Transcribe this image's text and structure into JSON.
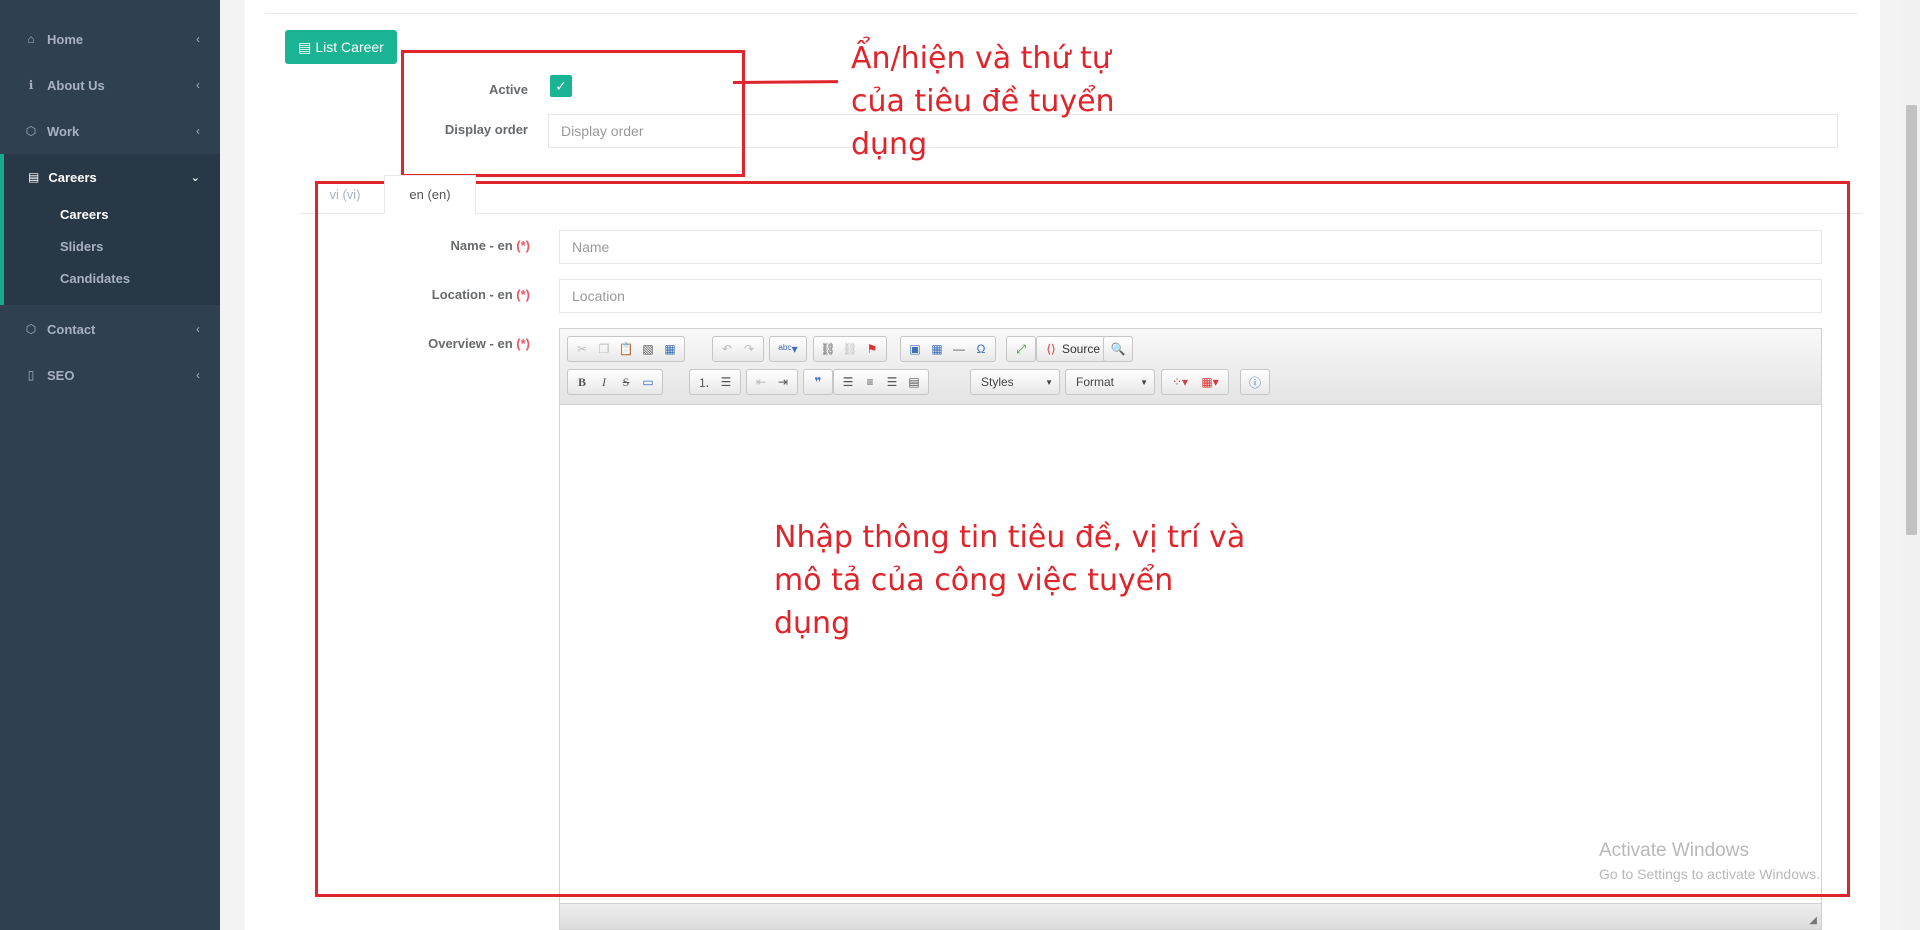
{
  "sidebar": {
    "items": [
      {
        "label": "Home",
        "icon": "home-icon"
      },
      {
        "label": "About Us",
        "icon": "info-icon"
      },
      {
        "label": "Work",
        "icon": "cube-icon"
      },
      {
        "label": "Careers",
        "icon": "id-card-icon"
      },
      {
        "label": "Contact",
        "icon": "cube-icon"
      },
      {
        "label": "SEO",
        "icon": "file-icon"
      }
    ],
    "careers_sub": [
      "Careers",
      "Sliders",
      "Candidates"
    ]
  },
  "header": {
    "list_button_label": "List Career"
  },
  "form": {
    "active_label": "Active",
    "active_checked": true,
    "display_order_label": "Display order",
    "display_order_placeholder": "Display order",
    "tabs": [
      {
        "label": "vi (vi)",
        "active": false
      },
      {
        "label": "en (en)",
        "active": true
      }
    ],
    "name_label": "Name - en",
    "location_label": "Location - en",
    "overview_label": "Overview - en",
    "required_mark": "(*)",
    "name_placeholder": "Name",
    "location_placeholder": "Location"
  },
  "editor": {
    "source_label": "Source",
    "styles_label": "Styles",
    "format_label": "Format"
  },
  "annotations": {
    "top_lines": [
      "Ẩn/hiện và thứ tự",
      "của tiêu đề tuyển",
      "dụng"
    ],
    "main_lines": [
      "Nhập thông tin tiêu đề, vị trí và",
      "mô tả của công việc tuyển",
      "dụng"
    ]
  },
  "watermark": {
    "title": "Activate Windows",
    "subtitle": "Go to Settings to activate Windows."
  },
  "colors": {
    "sidebar_bg": "#2f4050",
    "accent": "#1ab394",
    "annotation_red": "#e0242b",
    "required": "#ed5565"
  }
}
